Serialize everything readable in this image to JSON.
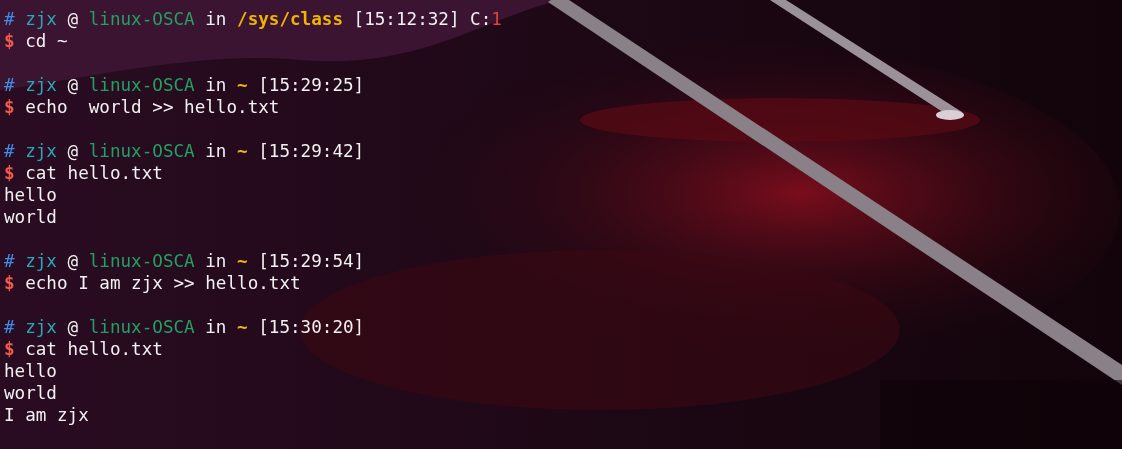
{
  "terminal": {
    "entries": [
      {
        "prompt": {
          "marker": "#",
          "user": "zjx",
          "at": "@",
          "host": "linux-OSCA",
          "in": "in",
          "directory": "/sys/class",
          "time": "[15:12:32]",
          "exit_label": "C:",
          "exit_code": "1"
        },
        "sign": "$",
        "command": "cd ~"
      },
      {
        "prompt": {
          "marker": "#",
          "user": "zjx",
          "at": "@",
          "host": "linux-OSCA",
          "in": "in",
          "directory": "~",
          "time": "[15:29:25]"
        },
        "sign": "$",
        "command": "echo  world >> hello.txt"
      },
      {
        "prompt": {
          "marker": "#",
          "user": "zjx",
          "at": "@",
          "host": "linux-OSCA",
          "in": "in",
          "directory": "~",
          "time": "[15:29:42]"
        },
        "sign": "$",
        "command": "cat hello.txt",
        "output": [
          "hello",
          "world"
        ]
      },
      {
        "prompt": {
          "marker": "#",
          "user": "zjx",
          "at": "@",
          "host": "linux-OSCA",
          "in": "in",
          "directory": "~",
          "time": "[15:29:54]"
        },
        "sign": "$",
        "command": "echo I am zjx >> hello.txt"
      },
      {
        "prompt": {
          "marker": "#",
          "user": "zjx",
          "at": "@",
          "host": "linux-OSCA",
          "in": "in",
          "directory": "~",
          "time": "[15:30:20]"
        },
        "sign": "$",
        "command": "cat hello.txt",
        "output": [
          "hello",
          "world",
          "I am zjx"
        ]
      }
    ]
  }
}
